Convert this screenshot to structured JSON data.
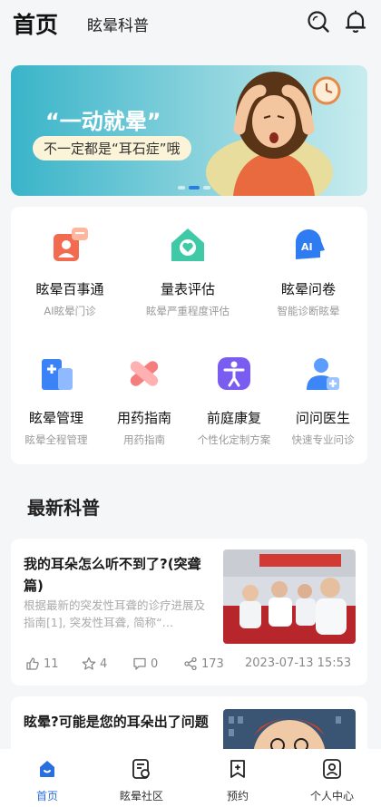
{
  "header": {
    "title": "首页",
    "subtitle": "眩晕科普",
    "icons": [
      "search-icon",
      "bell-icon"
    ]
  },
  "banner": {
    "headline": "“一动就晕”",
    "subline": "不一定都是“耳石症”哦",
    "active_slide": 2,
    "slide_count": 3
  },
  "services": [
    {
      "label": "眩晕百事通",
      "desc": "AI眩晕门诊",
      "icon": "chat-doctor-icon"
    },
    {
      "label": "量表评估",
      "desc": "眩晕严重程度评估",
      "icon": "health-home-icon"
    },
    {
      "label": "眩晕问卷",
      "desc": "智能诊断眩晕",
      "icon": "ai-head-icon"
    },
    {
      "label": "眩晕管理",
      "desc": "眩晕全程管理",
      "icon": "hospital-building-icon"
    },
    {
      "label": "用药指南",
      "desc": "用药指南",
      "icon": "pill-icon"
    },
    {
      "label": "前庭康复",
      "desc": "个性化定制方案",
      "icon": "rehab-person-icon"
    },
    {
      "label": "问问医生",
      "desc": "快速专业问诊",
      "icon": "doctor-icon"
    }
  ],
  "section": {
    "title": "最新科普"
  },
  "articles": [
    {
      "title": "我的耳朵怎么听不到了?(突聋篇)",
      "abstract": "根据最新的突发性耳聋的诊疗进展及指南[1], 突发性耳聋, 简称“…",
      "likes": "11",
      "favorites": "4",
      "comments": "0",
      "shares": "173",
      "date": "2023-07-13 15:53"
    },
    {
      "title": "眩晕?可能是您的耳朵出了问题"
    }
  ],
  "tabbar": [
    {
      "label": "首页",
      "icon": "home-icon",
      "active": true
    },
    {
      "label": "眩晕社区",
      "icon": "community-icon",
      "active": false
    },
    {
      "label": "预约",
      "icon": "bookmark-plus-icon",
      "active": false
    },
    {
      "label": "个人中心",
      "icon": "profile-icon",
      "active": false
    }
  ],
  "colors": {
    "accent": "#2a6fe0",
    "background": "#f5f6f8",
    "banner_start": "#39b4c9"
  }
}
